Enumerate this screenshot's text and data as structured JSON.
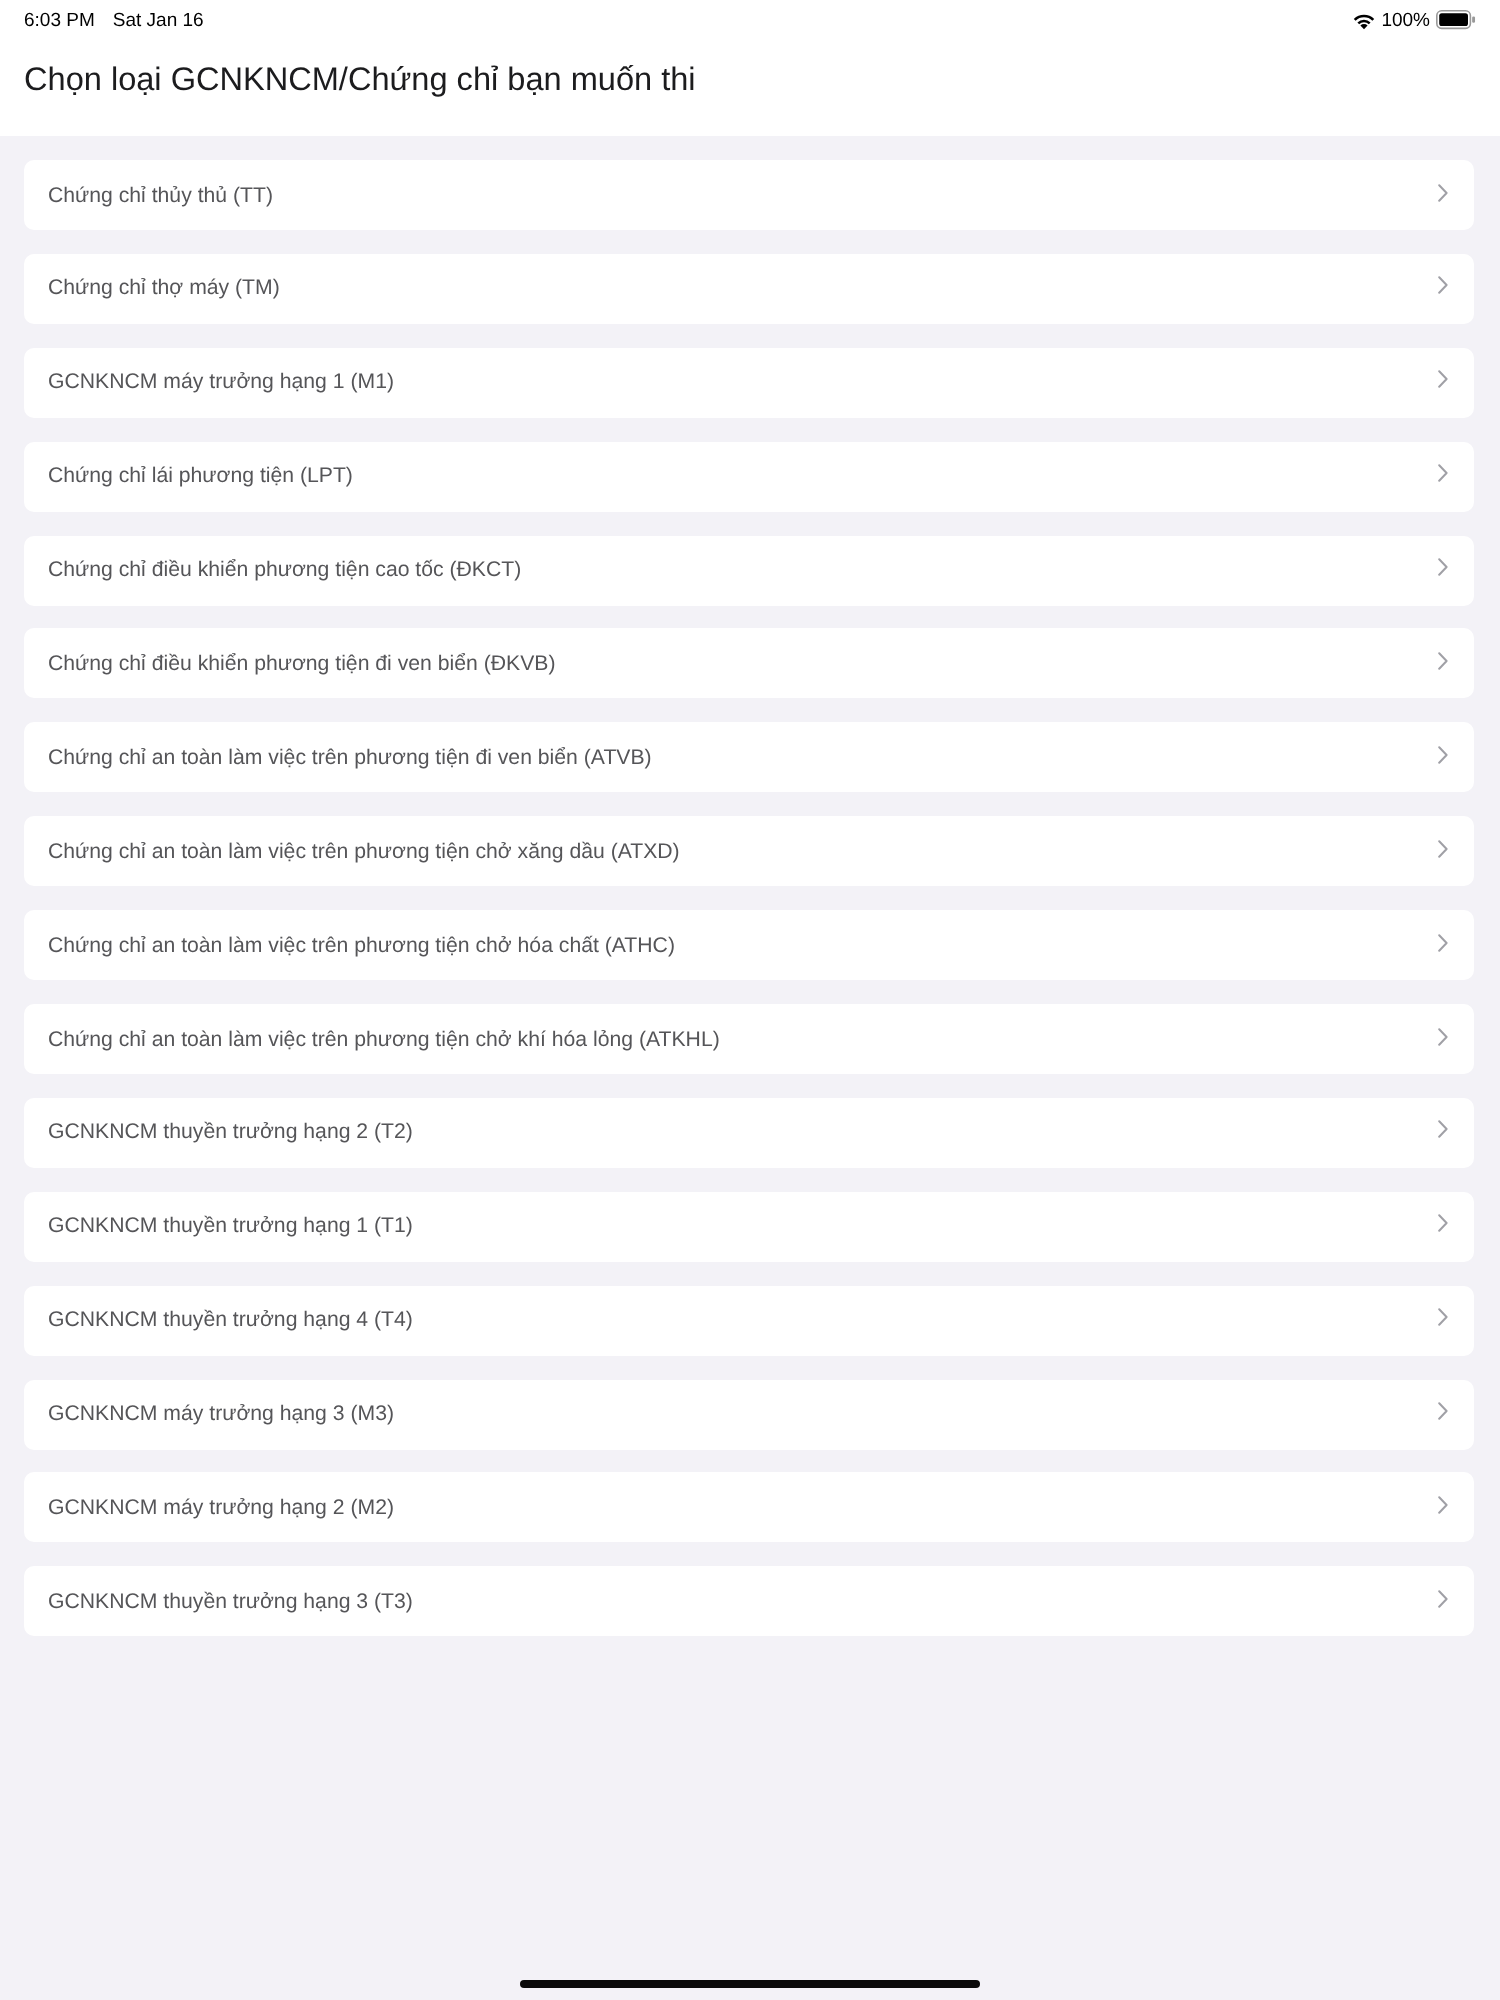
{
  "status_bar": {
    "time": "6:03 PM",
    "date": "Sat Jan 16",
    "battery": "100%"
  },
  "header": {
    "title": "Chọn loại GCNKNCM/Chứng chỉ bạn muốn thi"
  },
  "items": [
    {
      "label": "Chứng chỉ thủy thủ (TT)"
    },
    {
      "label": "Chứng chỉ thợ máy (TM)"
    },
    {
      "label": "GCNKNCM máy trưởng hạng 1 (M1)"
    },
    {
      "label": "Chứng chỉ lái phương tiện (LPT)"
    },
    {
      "label": "Chứng chỉ điều khiển phương tiện cao tốc (ĐKCT)"
    },
    {
      "label": "Chứng chỉ điều khiển phương tiện đi ven biển (ĐKVB)"
    },
    {
      "label": "Chứng chỉ an toàn làm việc trên phương tiện đi ven biển (ATVB)"
    },
    {
      "label": "Chứng chỉ an toàn làm việc trên phương tiện chở xăng dầu (ATXD)"
    },
    {
      "label": "Chứng chỉ an toàn làm việc trên phương tiện chở hóa chất (ATHC)"
    },
    {
      "label": "Chứng chỉ an toàn làm việc trên phương tiện chở khí hóa lỏng (ATKHL)"
    },
    {
      "label": "GCNKNCM thuyền trưởng hạng 2 (T2)"
    },
    {
      "label": "GCNKNCM thuyền trưởng hạng 1 (T1)"
    },
    {
      "label": "GCNKNCM thuyền trưởng hạng 4 (T4)"
    },
    {
      "label": "GCNKNCM máy trưởng hạng 3 (M3)"
    },
    {
      "label": "GCNKNCM máy trưởng hạng 2 (M2)"
    },
    {
      "label": "GCNKNCM thuyền trưởng hạng 3 (T3)"
    }
  ]
}
